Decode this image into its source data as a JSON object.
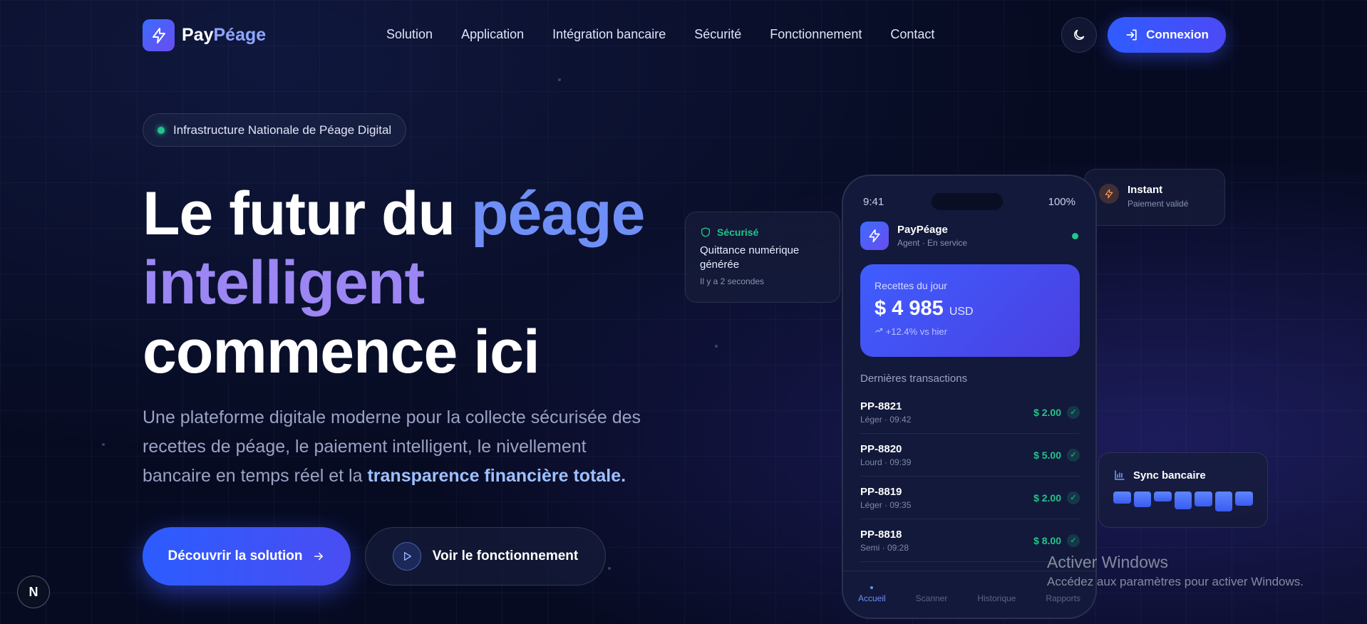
{
  "brand": {
    "name_part1": "Pay",
    "name_part2": "Péage"
  },
  "nav": {
    "items": [
      "Solution",
      "Application",
      "Intégration bancaire",
      "Sécurité",
      "Fonctionnement",
      "Contact"
    ]
  },
  "header": {
    "login_label": "Connexion"
  },
  "hero": {
    "badge": "Infrastructure Nationale de Péage Digital",
    "headline": {
      "line1_a": "Le futur du ",
      "line1_b": "péage",
      "line2": "intelligent",
      "line3": "commence ici"
    },
    "lede_text": "Une plateforme digitale moderne pour la collecte sécurisée des recettes de péage, le paiement intelligent, le nivellement bancaire en temps réel et la ",
    "lede_highlight": "transparence financière totale.",
    "cta_primary": "Découvrir la solution",
    "cta_secondary": "Voir le fonctionnement"
  },
  "secure_card": {
    "title": "Sécurisé",
    "message": "Quittance numérique générée",
    "time": "Il y a 2 secondes"
  },
  "instant_card": {
    "title": "Instant",
    "subtitle": "Paiement validé"
  },
  "sync_card": {
    "title": "Sync bancaire",
    "bars": [
      0.6,
      0.8,
      0.5,
      0.9,
      0.75,
      1.0,
      0.7
    ]
  },
  "phone": {
    "time": "9:41",
    "battery": "100%",
    "app_name": "PayPéage",
    "app_sub": "Agent · En service",
    "revenue": {
      "label": "Recettes du jour",
      "amount": "$ 4 985",
      "currency": "USD",
      "trend": "+12.4% vs hier"
    },
    "tx_title": "Dernières transactions",
    "transactions": [
      {
        "id": "PP-8821",
        "meta": "Léger · 09:42",
        "amount": "$ 2.00"
      },
      {
        "id": "PP-8820",
        "meta": "Lourd · 09:39",
        "amount": "$ 5.00"
      },
      {
        "id": "PP-8819",
        "meta": "Léger · 09:35",
        "amount": "$ 2.00"
      },
      {
        "id": "PP-8818",
        "meta": "Semi · 09:28",
        "amount": "$ 8.00"
      }
    ],
    "tabs": [
      "Accueil",
      "Scanner",
      "Historique",
      "Rapports"
    ]
  },
  "windows": {
    "line1": "Activer Windows",
    "line2": "Accédez aux paramètres pour activer Windows."
  },
  "dev_badge": "N",
  "colors": {
    "accent": "#3b6cff",
    "success": "#22c58b",
    "background": "#070b22"
  }
}
